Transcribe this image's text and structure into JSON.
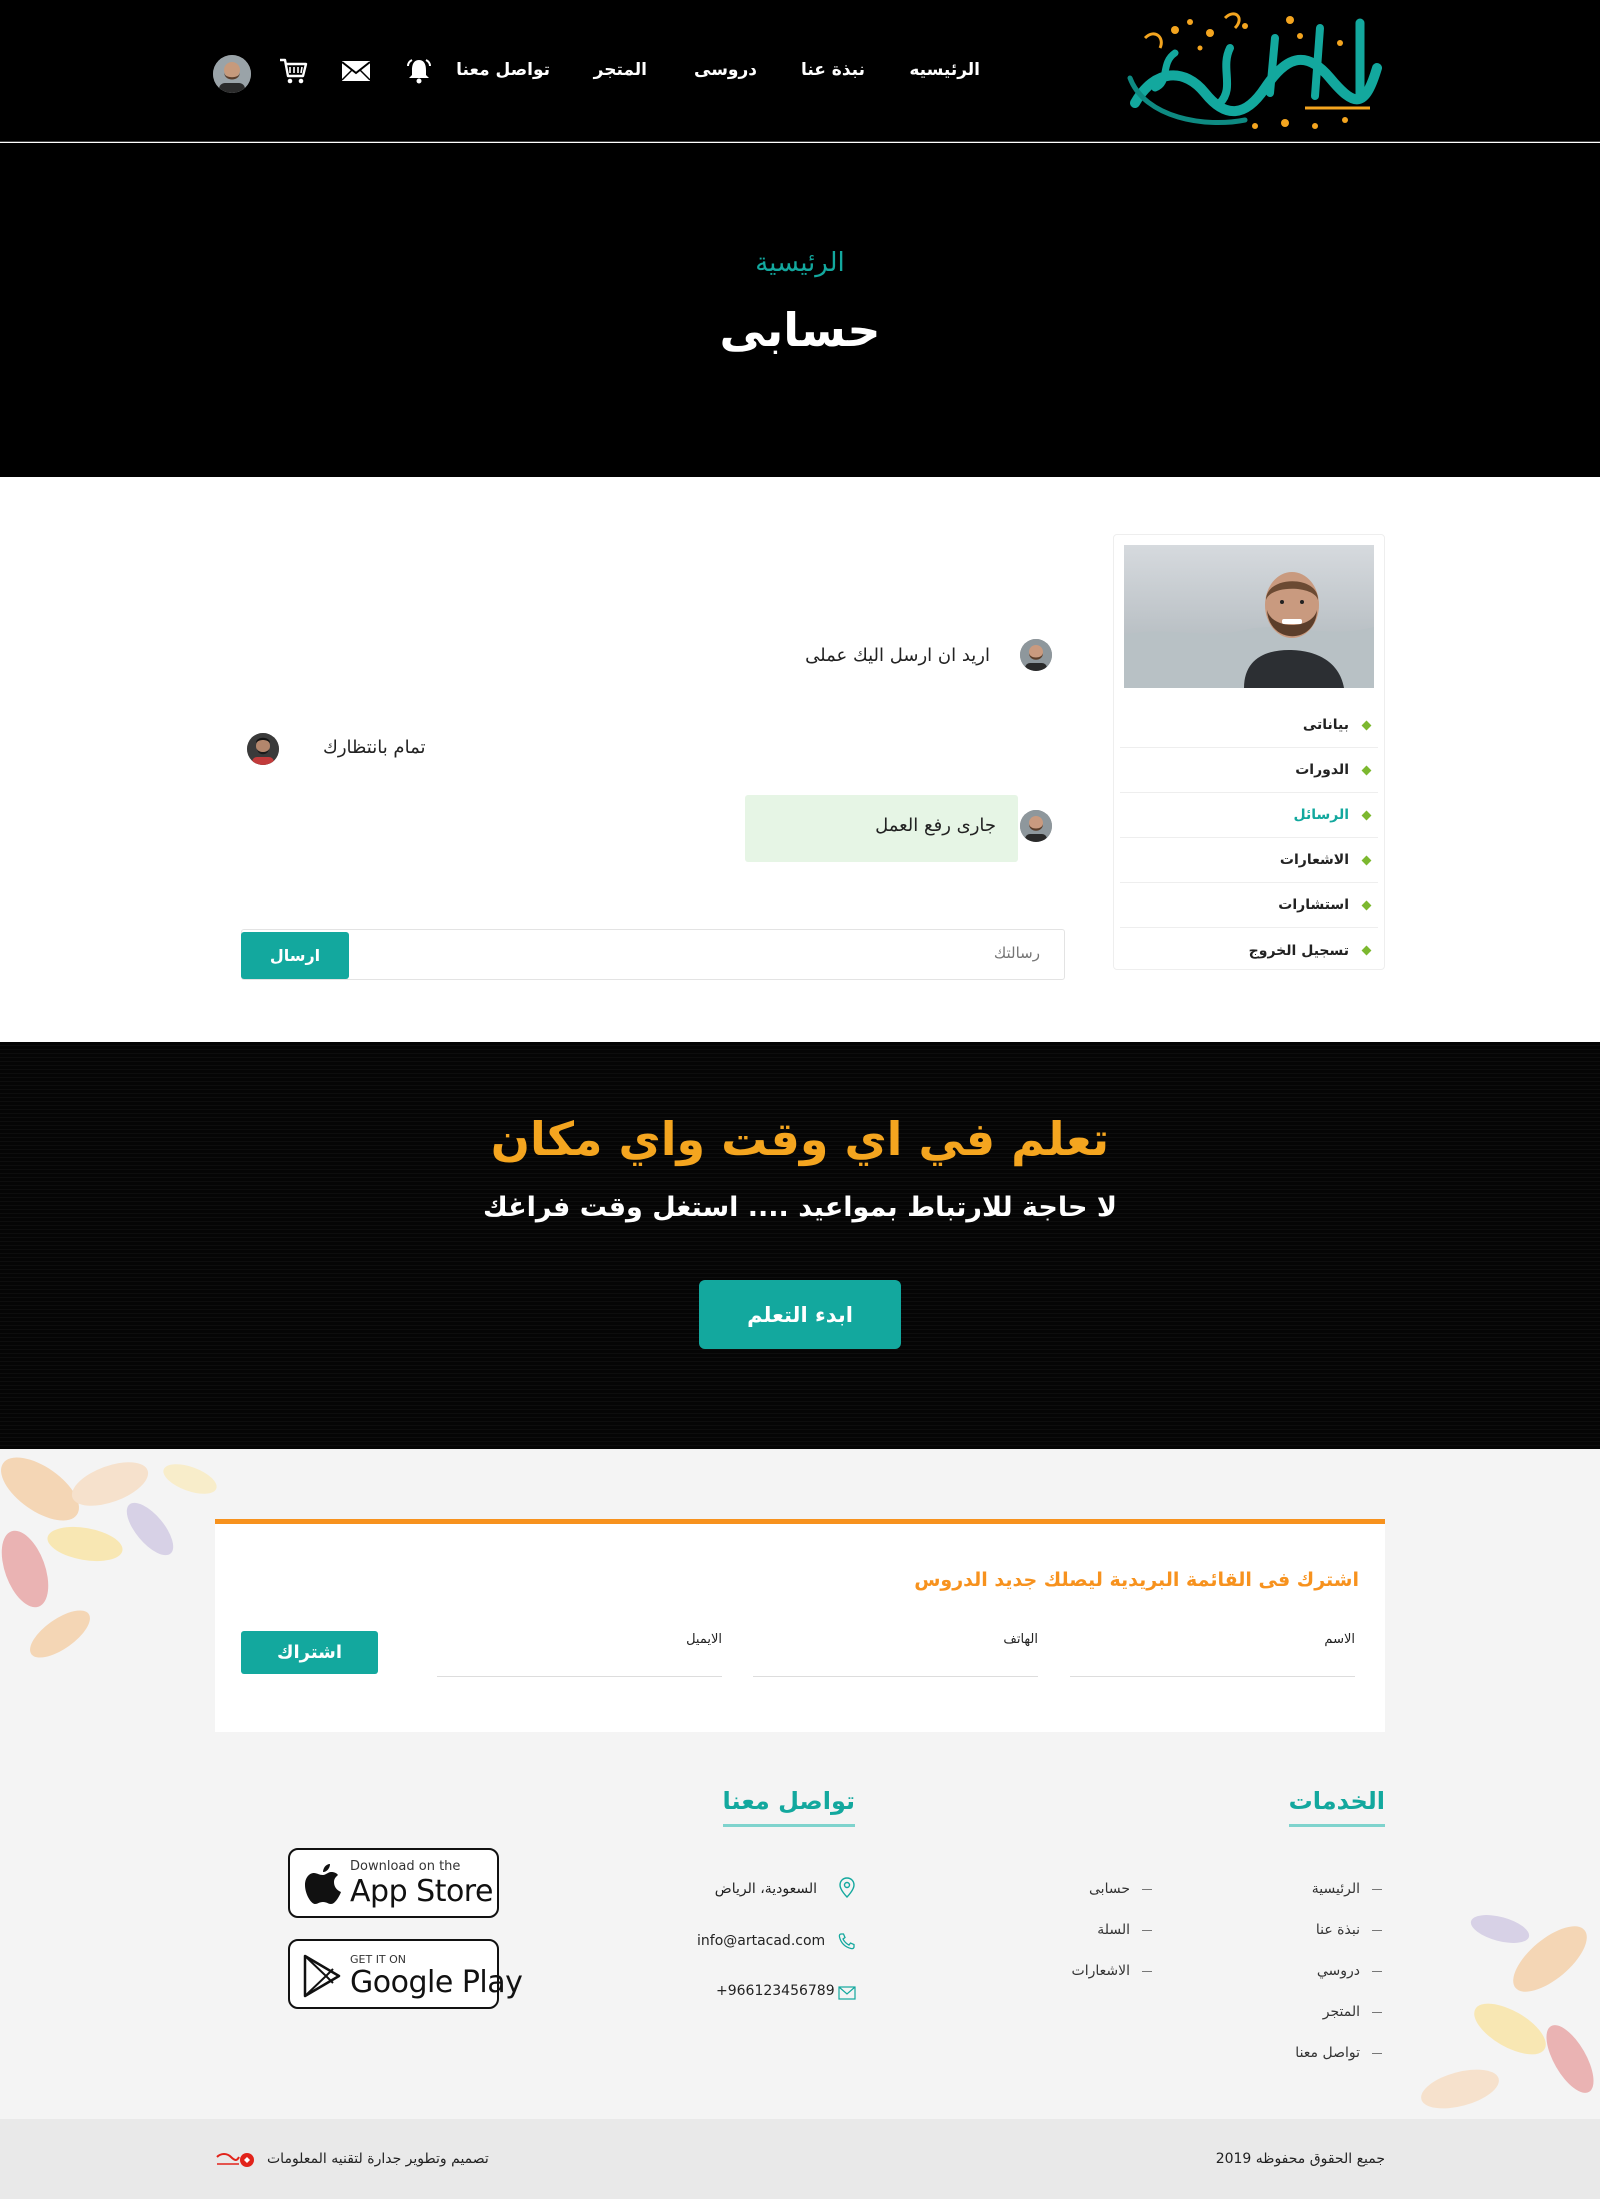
{
  "header": {
    "nav": [
      {
        "label": "الرئيسيه"
      },
      {
        "label": "نبذة عنا"
      },
      {
        "label": "دروسى"
      },
      {
        "label": "المتجر"
      },
      {
        "label": "تواصل معنا"
      }
    ],
    "icons": [
      "bell-icon",
      "mail-icon",
      "cart-icon",
      "user-avatar"
    ]
  },
  "hero": {
    "breadcrumb": "الرئيسية",
    "title": "حسابى"
  },
  "sidebar": {
    "items": [
      {
        "label": "بياناتى"
      },
      {
        "label": "الدورات"
      },
      {
        "label": "الرسائل"
      },
      {
        "label": "الاشعارات"
      },
      {
        "label": "استشارات"
      },
      {
        "label": "تسجيل الخروج"
      }
    ],
    "active_index": 2
  },
  "chat": {
    "messages": [
      {
        "text": "اريد ان ارسل اليك عملى"
      },
      {
        "text": "تمام بانتظارك"
      },
      {
        "text": "جارى رفع العمل"
      }
    ],
    "input_placeholder": "رسالتك",
    "send_label": "ارسال"
  },
  "cta": {
    "heading": "تعلم في اي وقت واي مكان",
    "subheading": "لا حاجة للارتباط بمواعيد .... استغل وقت فراغك",
    "button": "ابدء التعلم"
  },
  "subscribe": {
    "title": "اشترك فى القائمة البريدية ليصلك جديد الدروس",
    "fields": [
      "الاسم",
      "الهاتف",
      "الايميل"
    ],
    "button": "اشتراك"
  },
  "footer": {
    "services_title": "الخدمات",
    "services_col1": [
      "الرئيسية",
      "نبذة عنا",
      "دروسي",
      "المتجر",
      "تواصل معنا"
    ],
    "services_col2": [
      "حسابى",
      "السلة",
      "الاشعارات"
    ],
    "contact_title": "تواصل معنا",
    "contact": {
      "address": "السعودية، الرياض",
      "email": "info@artacad.com",
      "phone": "+966123456789"
    },
    "app_store": {
      "small": "Download on the",
      "big": "App Store"
    },
    "google_play": {
      "small": "GET IT ON",
      "big": "Google Play"
    },
    "copyright": "جميع الحقوق محفوظه 2019",
    "credit": "تصميم وتطوير جدارة لتقنيه المعلومات",
    "credit_logo_text": "جدارة"
  },
  "colors": {
    "teal": "#13a89e",
    "orange": "#f7921e",
    "cta_orange": "#f4a51f",
    "bubble_green": "#e6f5e5"
  }
}
